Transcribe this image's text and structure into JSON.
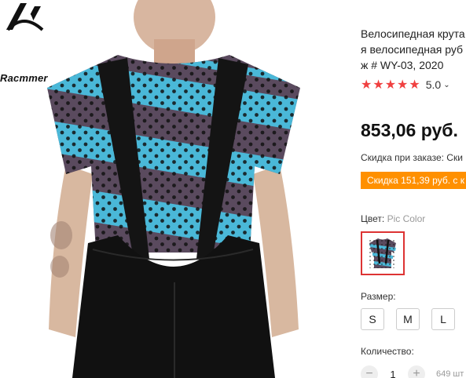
{
  "brand": {
    "logo_text": "Racmmer"
  },
  "product": {
    "title_lines": [
      "Велосипедная крута",
      "я велосипедная руб",
      "ж # WY-03, 2020"
    ],
    "stars": "★★★★★",
    "rating": "5.0",
    "price": "853,06 руб.",
    "promo_text": "Скидка при заказе: Ски",
    "promo_badge": "Скидка 151,39 руб. с к"
  },
  "color": {
    "label": "Цвет:",
    "value": "Pic Color"
  },
  "size": {
    "label": "Размер:",
    "options": [
      "S",
      "M",
      "L"
    ]
  },
  "quantity": {
    "label": "Количество:",
    "minus": "−",
    "value": "1",
    "plus": "+",
    "stock": "649 шт"
  },
  "colors": {
    "accent": "#f04040",
    "promo": "#ff9000",
    "selected_border": "#dd3333"
  }
}
